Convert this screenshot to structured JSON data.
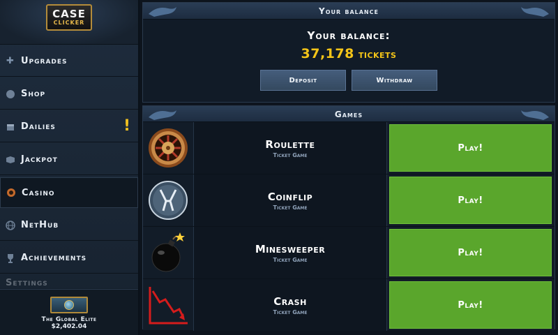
{
  "app": {
    "logo_top": "CASE",
    "logo_bottom": "CLICKER"
  },
  "sidebar": {
    "items": [
      {
        "label": "Upgrades",
        "icon": "plus-icon"
      },
      {
        "label": "Shop",
        "icon": "shop-icon"
      },
      {
        "label": "Dailies",
        "icon": "calendar-icon",
        "badge": "!"
      },
      {
        "label": "Jackpot",
        "icon": "jackpot-icon"
      },
      {
        "label": "Casino",
        "icon": "casino-chip-icon",
        "active": true
      },
      {
        "label": "NetHub",
        "icon": "globe-icon"
      },
      {
        "label": "Achievements",
        "icon": "trophy-icon"
      },
      {
        "label": "Settings",
        "icon": "gear-icon"
      }
    ]
  },
  "profile": {
    "rank": "The Global Elite",
    "money": "$2,402.04"
  },
  "balance_panel": {
    "header": "Your balance",
    "title": "Your balance:",
    "amount": "37,178",
    "unit": "tickets",
    "deposit_label": "Deposit",
    "withdraw_label": "Withdraw"
  },
  "games_panel": {
    "header": "Games",
    "games": [
      {
        "name": "Roulette",
        "subtitle": "Ticket Game",
        "play_label": "Play!",
        "icon": "roulette-wheel-icon"
      },
      {
        "name": "Coinflip",
        "subtitle": "Ticket Game",
        "play_label": "Play!",
        "icon": "coin-emblem-icon"
      },
      {
        "name": "Minesweeper",
        "subtitle": "Ticket Game",
        "play_label": "Play!",
        "icon": "bomb-icon"
      },
      {
        "name": "Crash",
        "subtitle": "Ticket Game",
        "play_label": "Play!",
        "icon": "crash-chart-icon"
      }
    ]
  },
  "colors": {
    "accent_yellow": "#f5c518",
    "play_green": "#5aa62c",
    "panel_bg": "#111b27"
  }
}
